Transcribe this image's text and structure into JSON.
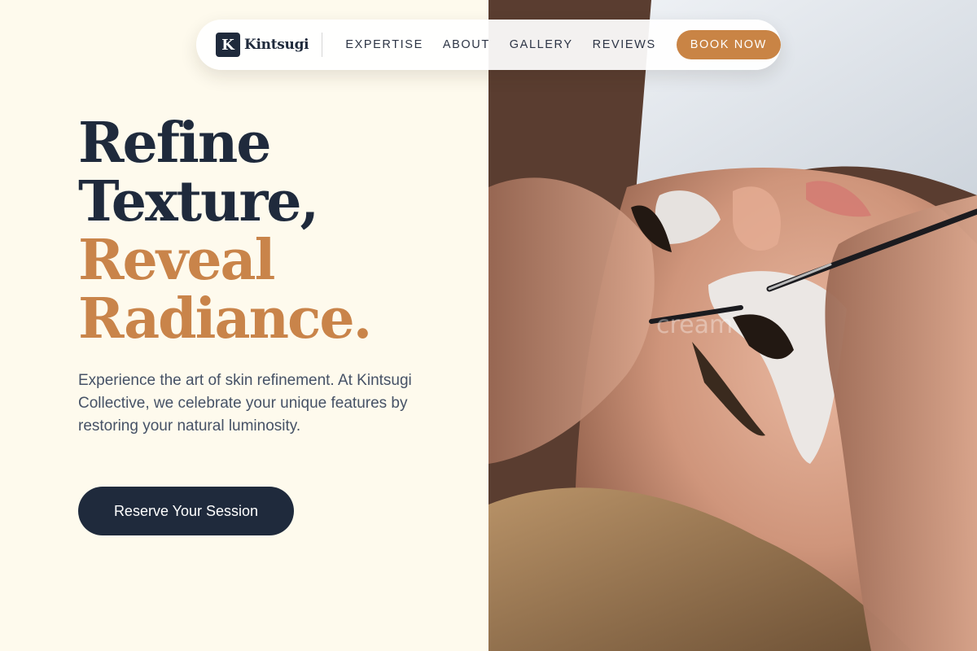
{
  "brand": {
    "mark": "K",
    "name": "Kintsugi"
  },
  "nav": {
    "links": [
      "EXPERTISE",
      "ABOUT",
      "GALLERY",
      "REVIEWS"
    ],
    "book_label": "BOOK NOW"
  },
  "hero": {
    "line1": "Refine",
    "line2": "Texture,",
    "line3": "Reveal",
    "line4": "Radiance.",
    "description": "Experience the art of skin refinement. At Kintsugi Collective, we celebrate your unique features by restoring your natural luminosity.",
    "cta_label": "Reserve Your Session"
  },
  "photo": {
    "watermark": "cream"
  },
  "colors": {
    "navy": "#1f2a3c",
    "accent": "#c98445",
    "background": "#fefaed",
    "body_text": "#465266"
  }
}
